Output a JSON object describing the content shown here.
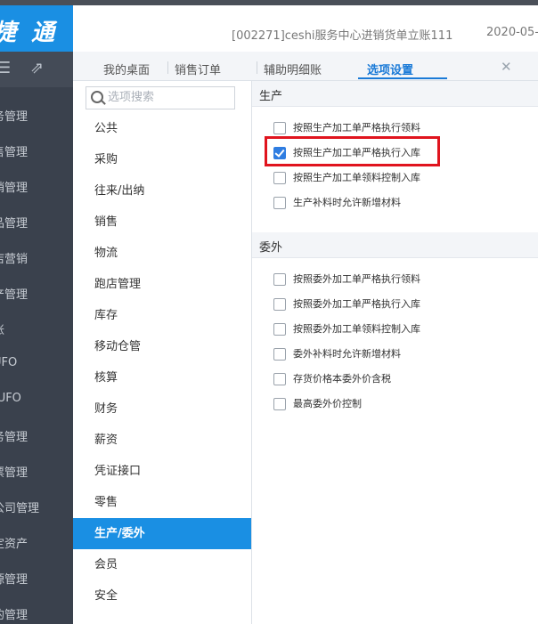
{
  "brand": {
    "logo_text": "捷 通"
  },
  "header": {
    "title": "[002271]ceshi服务中心进销货单立账111",
    "date": "2020-05-"
  },
  "sidebar": {
    "items": [
      "务管理",
      "售管理",
      "销管理",
      "品管理",
      "店营销",
      "产管理",
      "账",
      "UFO",
      "-UFO",
      "务管理",
      "票管理",
      "公司管理",
      "定资产",
      "源管理",
      "的管理"
    ]
  },
  "tabs": [
    {
      "label": "我的桌面"
    },
    {
      "label": "销售订单"
    },
    {
      "label": "辅助明细账"
    },
    {
      "label": "选项设置",
      "active": true
    }
  ],
  "search": {
    "placeholder": "选项搜索"
  },
  "categories": [
    "公共",
    "采购",
    "往来/出纳",
    "销售",
    "物流",
    "跑店管理",
    "库存",
    "移动仓管",
    "核算",
    "财务",
    "薪资",
    "凭证接口",
    "零售",
    "生产/委外",
    "会员",
    "安全"
  ],
  "active_category": "生产/委外",
  "sections": [
    {
      "title": "生产",
      "options": [
        {
          "label": "按照生产加工单严格执行领料",
          "checked": false
        },
        {
          "label": "按照生产加工单严格执行入库",
          "checked": true
        },
        {
          "label": "按照生产加工单领料控制入库",
          "checked": false
        },
        {
          "label": "生产补料时允许新增材料",
          "checked": false
        }
      ]
    },
    {
      "title": "委外",
      "options": [
        {
          "label": "按照委外加工单严格执行领料",
          "checked": false
        },
        {
          "label": "按照委外加工单严格执行入库",
          "checked": false
        },
        {
          "label": "按照委外加工单领料控制入库",
          "checked": false
        },
        {
          "label": "委外补料时允许新增材料",
          "checked": false
        },
        {
          "label": "存货价格本委外价含税",
          "checked": false
        },
        {
          "label": "最高委外价控制",
          "checked": false
        }
      ]
    }
  ],
  "colors": {
    "brand": "#1a8fe3",
    "sidebar": "#3a414d",
    "accent": "#1a7ad7",
    "highlight": "#e0141e"
  }
}
